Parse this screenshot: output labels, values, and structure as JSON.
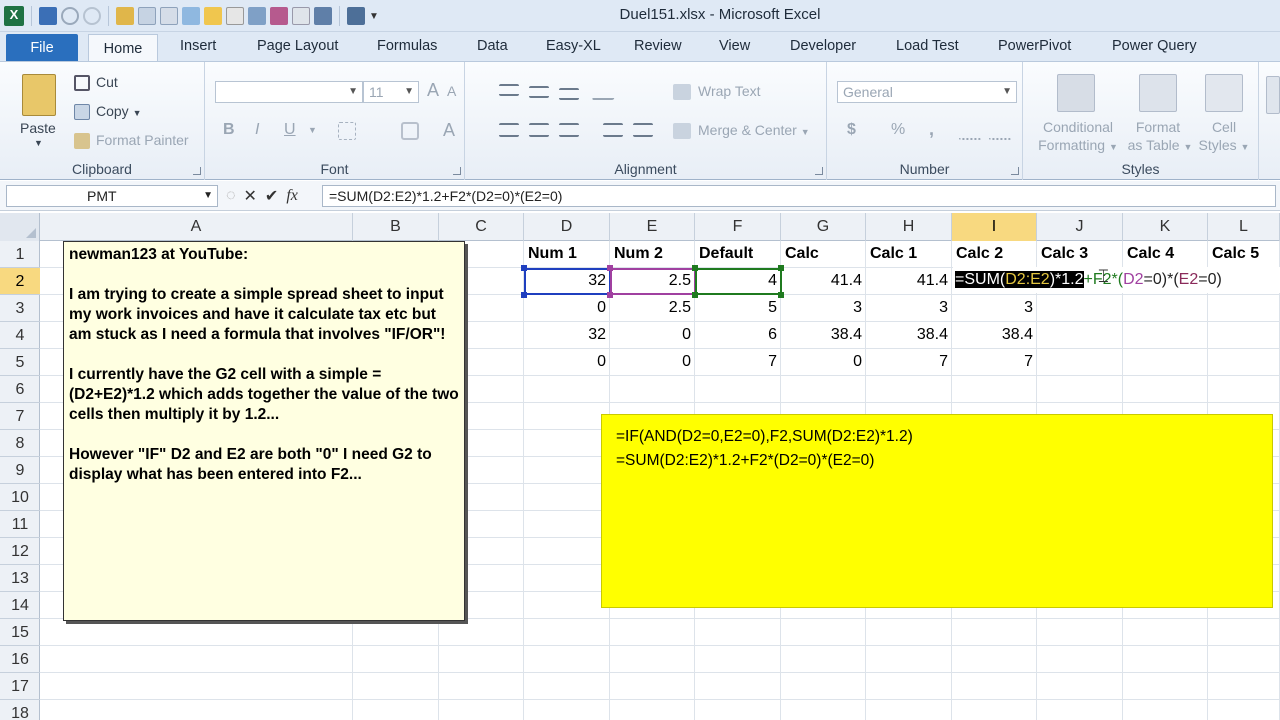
{
  "window": {
    "title": "Duel151.xlsx - Microsoft Excel"
  },
  "tabs": [
    "File",
    "Home",
    "Insert",
    "Page Layout",
    "Formulas",
    "Data",
    "Easy-XL",
    "Review",
    "View",
    "Developer",
    "Load Test",
    "PowerPivot",
    "Power Query"
  ],
  "ribbon": {
    "clipboard": {
      "paste": "Paste",
      "cut": "Cut",
      "copy": "Copy",
      "format_painter": "Format Painter",
      "label": "Clipboard"
    },
    "font": {
      "size": "11",
      "bold": "B",
      "italic": "I",
      "underline": "U",
      "label": "Font"
    },
    "alignment": {
      "wrap_text": "Wrap Text",
      "merge_center": "Merge & Center",
      "label": "Alignment"
    },
    "number": {
      "format": "General",
      "currency": "$",
      "percent": "%",
      "comma": ",",
      "label": "Number"
    },
    "styles": {
      "conditional_line1": "Conditional",
      "conditional_line2": "Formatting",
      "format_table_line1": "Format",
      "format_table_line2": "as Table",
      "cell_styles_line1": "Cell",
      "cell_styles_line2": "Styles",
      "label": "Styles"
    }
  },
  "formula_bar": {
    "name_box": "PMT",
    "formula": "=SUM(D2:E2)*1.2+F2*(D2=0)*(E2=0)"
  },
  "columns": [
    "A",
    "B",
    "C",
    "D",
    "E",
    "F",
    "G",
    "H",
    "I",
    "J",
    "K",
    "L"
  ],
  "rows": [
    "1",
    "2",
    "3",
    "4",
    "5",
    "6",
    "7",
    "8",
    "9",
    "10",
    "11",
    "12",
    "13",
    "14",
    "15",
    "16",
    "17",
    "18"
  ],
  "sheet": {
    "headers": {
      "D": "Num 1",
      "E": "Num 2",
      "F": "Default",
      "G": "Calc",
      "H": "Calc 1",
      "I": "Calc 2",
      "J": "Calc 3",
      "K": "Calc 4",
      "L": "Calc 5"
    },
    "rows": [
      {
        "D": "32",
        "E": "2.5",
        "F": "4",
        "G": "41.4",
        "H": "41.4"
      },
      {
        "D": "0",
        "E": "2.5",
        "F": "5",
        "G": "3",
        "H": "3",
        "I": "3"
      },
      {
        "D": "32",
        "E": "0",
        "F": "6",
        "G": "38.4",
        "H": "38.4",
        "I": "38.4"
      },
      {
        "D": "0",
        "E": "0",
        "F": "7",
        "G": "0",
        "H": "7",
        "I": "7"
      }
    ]
  },
  "edit_cell": {
    "p1": "=SUM(",
    "p2": "D2:E2",
    "p3": ")*1.2",
    "p4": "+F2*(",
    "p5": "D2",
    "p6": "=0)*(",
    "p7": "E2",
    "p8": "=0)"
  },
  "comment": {
    "title": "newman123 at YouTube:",
    "para1": "I am trying to create a simple spread sheet to input my work invoices and have it calculate tax etc but am stuck as I need a formula that involves \"IF/OR\"!",
    "para2": "I currently have the G2 cell with a simple =(D2+E2)*1.2 which adds together the value of the two cells then multiply it by 1.2...",
    "para3": "However \"IF\" D2 and E2 are both \"0\" I need G2 to display what has been entered into F2..."
  },
  "yellow_box": {
    "line1": "=IF(AND(D2=0,E2=0),F2,SUM(D2:E2)*1.2)",
    "line2": "=SUM(D2:E2)*1.2+F2*(D2=0)*(E2=0)"
  },
  "colors": {
    "file_tab": "#2a6fbe",
    "active_header": "#f8d980",
    "yellow_box": "#ffff00",
    "comment_bg": "#ffffe1",
    "ref_blue": "#1f3fbf",
    "ref_purple": "#a040a0",
    "ref_green": "#1f7a1f"
  }
}
